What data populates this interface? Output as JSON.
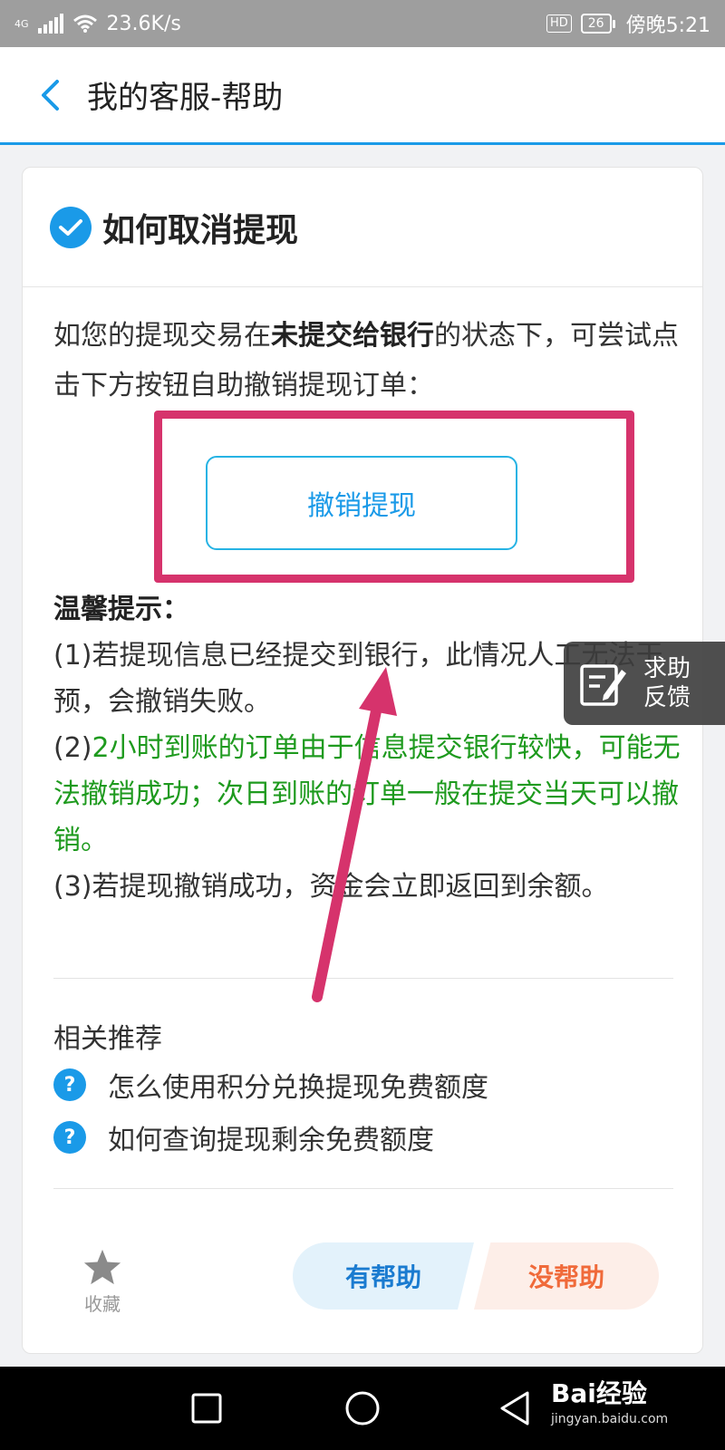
{
  "status_bar": {
    "network_type": "4G",
    "speed": "23.6K/s",
    "hd": "HD",
    "battery": "26",
    "time": "傍晚5:21"
  },
  "header": {
    "title": "我的客服-帮助"
  },
  "article": {
    "title": "如何取消提现",
    "intro_part1": "如您的提现交易在",
    "intro_bold": "未提交给银行",
    "intro_part2": "的状态下，可尝试点击下方按钮自助撤销提现订单：",
    "cancel_button": "撤销提现",
    "tips_heading": "温馨提示：",
    "tip1": "(1)若提现信息已经提交到银行，此情况人工无法干预，会撤销失败。",
    "tip2_prefix": "(2)",
    "tip2_green": "2小时到账的订单由于信息提交银行较快，可能无法撤销成功；次日到账的订单一般在提交当天可以撤销。",
    "tip3": "(3)若提现撤销成功，资金会立即返回到余额。"
  },
  "related": {
    "title": "相关推荐",
    "items": [
      "怎么使用积分兑换提现免费额度",
      "如何查询提现剩余免费额度"
    ]
  },
  "feedback": {
    "favorite_label": "收藏",
    "helpful_label": "有帮助",
    "unhelpful_label": "没帮助"
  },
  "float_button": {
    "line1": "求助",
    "line2": "反馈"
  },
  "watermark": {
    "main": "Bai经验",
    "sub": "jingyan.baidu.com"
  },
  "colors": {
    "accent": "#1a9ae8",
    "highlight": "#d6336c",
    "tip_green": "#1e9a1e",
    "unhelpful": "#f06a3a"
  }
}
